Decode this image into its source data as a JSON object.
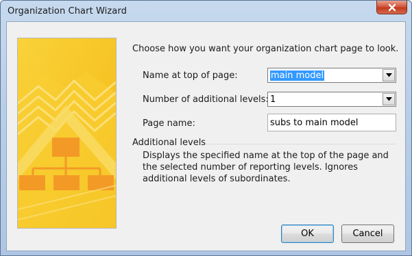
{
  "window": {
    "title": "Organization Chart Wizard"
  },
  "prompt": "Choose how you want your organization chart page to look.",
  "fields": {
    "name_at_top": {
      "label": "Name at top of page:",
      "value": "main model"
    },
    "additional_levels": {
      "label": "Number of additional levels:",
      "value": "1"
    },
    "page_name": {
      "label": "Page name:",
      "value": "subs to main model"
    }
  },
  "help": {
    "title": "Additional levels",
    "description": "Displays the specified name at the top of the page and the selected number of reporting levels. Ignores additional levels of subordinates."
  },
  "buttons": {
    "ok": "OK",
    "cancel": "Cancel"
  },
  "colors": {
    "art_background": "#f7c82a",
    "selection_highlight": "#3399ff",
    "close_button": "#c94a2e"
  },
  "icons": {
    "close": "close-icon",
    "dropdown": "chevron-down-icon",
    "wizard_art": "org-chart-illustration"
  }
}
